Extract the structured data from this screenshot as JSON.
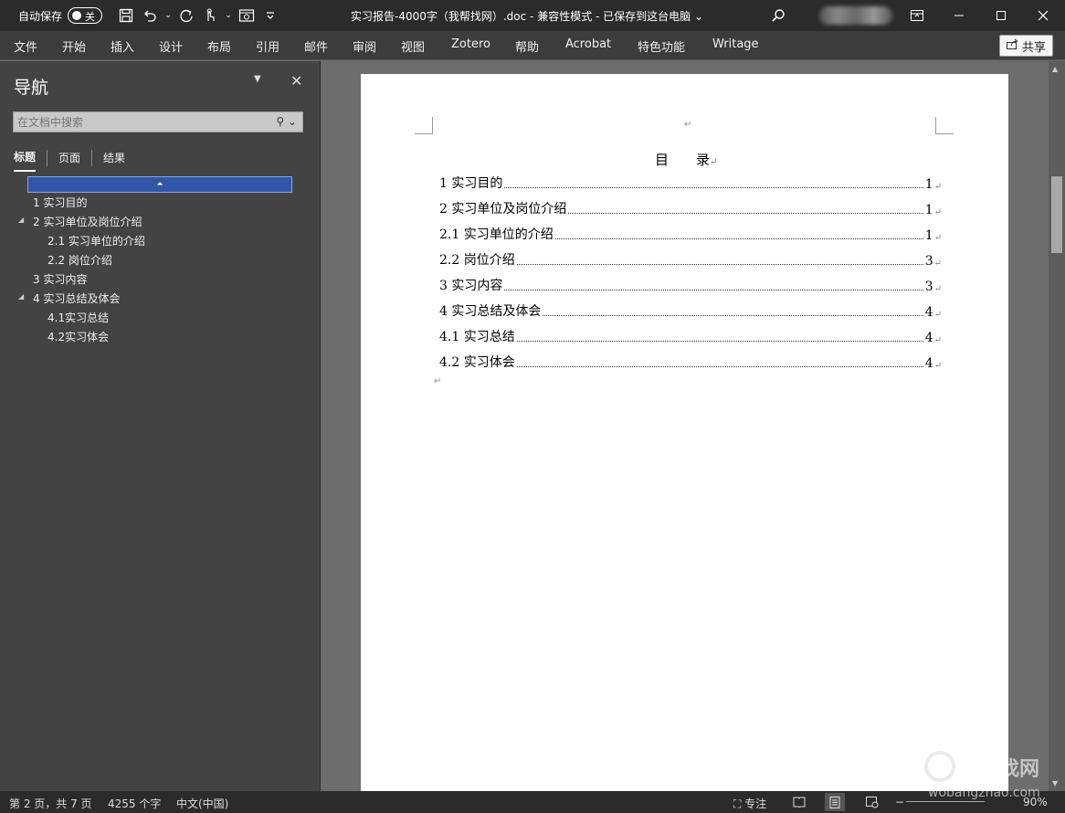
{
  "titlebar": {
    "autosave_label": "自动保存",
    "autosave_state": "关",
    "document_title": "实习报告-4000字（我帮找网）.doc  -  兼容性模式  -  已保存到这台电脑 ⌄",
    "icons": [
      "save-icon",
      "undo-icon",
      "redo-icon",
      "touch-mode-icon",
      "print-preview-icon",
      "customize-qat-icon"
    ]
  },
  "ribbon": {
    "tabs": [
      "文件",
      "开始",
      "插入",
      "设计",
      "布局",
      "引用",
      "邮件",
      "审阅",
      "视图",
      "Zotero",
      "帮助",
      "Acrobat",
      "特色功能",
      "Writage"
    ],
    "share_label": "共享"
  },
  "navigation": {
    "title": "导航",
    "search_placeholder": "在文档中搜索",
    "tabs": [
      "标题",
      "页面",
      "结果"
    ],
    "headings": [
      "1 实习目的",
      "2 实习单位及岗位介绍",
      "2.1 实习单位的介绍",
      "2.2 岗位介绍",
      "3 实习内容",
      "4 实习总结及体会",
      "4.1实习总结",
      "4.2实习体会"
    ]
  },
  "document": {
    "toc_title": "目　　录",
    "paragraph_mark": "↵",
    "toc": [
      {
        "text": "1  实习目的",
        "page": "1"
      },
      {
        "text": "2  实习单位及岗位介绍",
        "page": "1"
      },
      {
        "text": "2.1  实习单位的介绍",
        "page": "1"
      },
      {
        "text": "2.2  岗位介绍",
        "page": "3"
      },
      {
        "text": "3  实习内容",
        "page": "3"
      },
      {
        "text": "4  实习总结及体会",
        "page": "4"
      },
      {
        "text": "4.1 实习总结",
        "page": "4"
      },
      {
        "text": "4.2 实习体会",
        "page": "4"
      }
    ]
  },
  "statusbar": {
    "page_info": "第 2 页，共 7 页",
    "word_count": "4255 个字",
    "language": "中文(中国)",
    "focus_label": "专注",
    "zoom": "90%"
  },
  "watermark": {
    "text_cn": "我帮找网",
    "text_url": "wobangzhao.com"
  }
}
